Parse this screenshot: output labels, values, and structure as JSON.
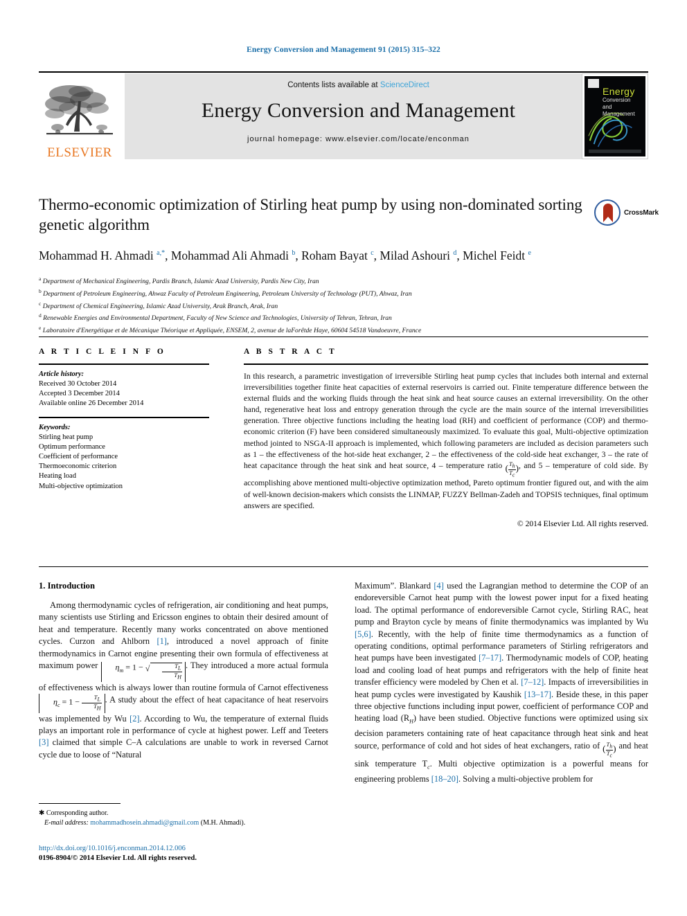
{
  "running_head": "Energy Conversion and Management 91 (2015) 315–322",
  "header": {
    "contents_prefix": "Contents lists available at ",
    "sciencedirect": "ScienceDirect",
    "journal_title": "Energy Conversion and Management",
    "journal_homepage": "journal homepage: www.elsevier.com/locate/enconman",
    "publisher_logo_text": "ELSEVIER",
    "cover": {
      "line1": "Energy",
      "line2": "Conversion",
      "line3": "and Management"
    }
  },
  "crossmark": {
    "label": "CrossMark"
  },
  "title": "Thermo-economic optimization of Stirling heat pump by using non-dominated sorting genetic algorithm",
  "authors_html": "Mohammad H. Ahmadi <sup>a,*</sup>, Mohammad Ali Ahmadi <sup>b</sup>, Roham Bayat <sup>c</sup>, Milad Ashouri <sup>d</sup>, Michel Feidt <sup>e</sup>",
  "affiliations": [
    {
      "marker": "a",
      "text": "Department of Mechanical Engineering, Pardis Branch, Islamic Azad University, Pardis New City, Iran"
    },
    {
      "marker": "b",
      "text": "Department of Petroleum Engineering, Ahwaz Faculty of Petroleum Engineering, Petroleum University of Technology (PUT), Ahwaz, Iran"
    },
    {
      "marker": "c",
      "text": "Department of Chemical Engineering, Islamic Azad University, Arak Branch, Arak, Iran"
    },
    {
      "marker": "d",
      "text": "Renewable Energies and Environmental Department, Faculty of New Science and Technologies, University of Tehran, Tehran, Iran"
    },
    {
      "marker": "e",
      "text": "Laboratoire d'Energétique et de Mécanique Théorique et Appliquée, ENSEM, 2, avenue de laForêtde Haye, 60604 54518 Vandoeuvre, France"
    }
  ],
  "article_info": {
    "heading": "A R T I C L E   I N F O",
    "history_label": "Article history:",
    "history": [
      "Received 30 October 2014",
      "Accepted 3 December 2014",
      "Available online 26 December 2014"
    ],
    "keywords_label": "Keywords:",
    "keywords": [
      "Stirling heat pump",
      "Optimum performance",
      "Coefficient of performance",
      "Thermoeconomic criterion",
      "Heating load",
      "Multi-objective optimization"
    ]
  },
  "abstract": {
    "heading": "A B S T R A C T",
    "part1": "In this research, a parametric investigation of irreversible Stirling heat pump cycles that includes both internal and external irreversibilities together finite heat capacities of external reservoirs is carried out. Finite temperature difference between the external fluids and the working fluids through the heat sink and heat source causes an external irreversibility. On the other hand, regenerative heat loss and entropy generation through the cycle are the main source of the internal irreversibilities generation. Three objective functions including the heating load (RH) and coefficient of performance (COP) and thermo-economic criterion (F) have been considered simultaneously maximized. To evaluate this goal, Multi-objective optimization method jointed to NSGA-II approach is implemented, which following parameters are included as decision parameters such as 1 – the effectiveness of the hot-side heat exchanger, 2 – the effectiveness of the cold-side heat exchanger, 3 – the rate of heat capacitance through the heat sink and heat source, 4 – temperature ratio ",
    "ratio_num": "T",
    "ratio_num_sub": "h",
    "ratio_den": "T",
    "ratio_den_sub": "c",
    "part2": ", and 5 – temperature of cold side. By accomplishing above mentioned multi-objective optimization method, Pareto optimum frontier figured out, and with the aim of well-known decision-makers which consists the LINMAP, FUZZY Bellman-Zadeh and TOPSIS techniques, final optimum answers are specified.",
    "copyright": "© 2014 Elsevier Ltd. All rights reserved."
  },
  "intro": {
    "heading": "1. Introduction",
    "left": {
      "p1_a": "Among thermodynamic cycles of refrigeration, air conditioning and heat pumps, many scientists use Stirling and Ericsson engines to obtain their desired amount of heat and temperature. Recently many works concentrated on above mentioned cycles. Curzon and Ahlborn ",
      "ref1": "[1]",
      "p1_b": ", introduced a novel approach of finite thermodynamics in Carnot engine presenting their own formula of effectiveness at maximum power ",
      "eq1": {
        "lhs": "η",
        "lhs_sub": "m",
        "op": "= 1 −",
        "num": "T",
        "num_sub": "L",
        "den": "T",
        "den_sub": "H"
      },
      "p1_c": ". They introduced a more actual formula of effectiveness which is always lower than routine formula of Carnot effectiveness ",
      "eq2": {
        "lhs": "η",
        "lhs_sub": "c",
        "op": "= 1 −",
        "num": "T",
        "num_sub": "L",
        "den": "T",
        "den_sub": "H"
      },
      "p1_d": ". A study about the effect of heat capacitance of heat reservoirs was implemented by Wu ",
      "ref2": "[2]",
      "p1_e": ". According to Wu, the temperature of external fluids plays an important role in performance of cycle at highest power. Leff and Teeters ",
      "ref3": "[3]",
      "p1_f": " claimed that simple C–A calculations are unable to work in reversed Carnot cycle due to loose of “Natural"
    },
    "right": {
      "p_a": "Maximum”. Blankard ",
      "ref4": "[4]",
      "p_b": " used the Lagrangian method to determine the COP of an endoreversible Carnot heat pump with the lowest power input for a fixed heating load. The optimal performance of endoreversible Carnot cycle, Stirling RAC, heat pump and Brayton cycle by means of finite thermodynamics was implanted by Wu ",
      "ref56": "[5,6]",
      "p_c": ". Recently, with the help of finite time thermodynamics as a function of operating conditions, optimal performance parameters of Stirling refrigerators and heat pumps have been investigated ",
      "ref717": "[7–17]",
      "p_d": ". Thermodynamic models of COP, heating load and cooling load of heat pumps and refrigerators with the help of finite heat transfer efficiency were modeled by Chen et al. ",
      "ref712": "[7–12]",
      "p_e": ". Impacts of irreversibilities in heat pump cycles were investigated by Kaushik ",
      "ref1317": "[13–17]",
      "p_f": ". Beside these, in this paper three objective functions including input power, coefficient of performance COP and heating load (R",
      "rh_sub": "H",
      "p_g": ") have been studied. Objective functions were optimized using six decision parameters containing rate of heat capacitance through heat sink and heat source, performance of cold and hot sides of heat exchangers, ratio of ",
      "ratio_num": "T",
      "ratio_num_sub": "h",
      "ratio_den": "T",
      "ratio_den_sub": "c",
      "p_h": " and heat sink temperature T",
      "tc_sub": "c",
      "p_i": ". Multi objective optimization is a powerful means for engineering problems ",
      "ref1820": "[18–20]",
      "p_j": ". Solving a multi-objective problem for"
    }
  },
  "footnote": {
    "corresponding": "Corresponding author.",
    "email_label": "E-mail address:",
    "email": "mohammadhosein.ahmadi@gmail.com",
    "email_suffix": "(M.H. Ahmadi)."
  },
  "footer": {
    "doi": "http://dx.doi.org/10.1016/j.enconman.2014.12.006",
    "issn": "0196-8904/© 2014 Elsevier Ltd. All rights reserved."
  },
  "colors": {
    "link": "#1a6ea8",
    "elsevier_orange": "#E87722",
    "masthead_bg": "#e3e3e3"
  }
}
